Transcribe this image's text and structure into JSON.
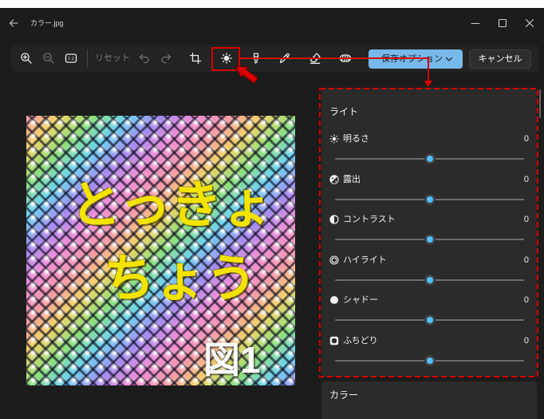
{
  "window": {
    "title": "カラー.jpg",
    "back_icon": "back-arrow-icon",
    "controls": [
      "minimize-icon",
      "maximize-icon",
      "close-icon"
    ]
  },
  "toolbar": {
    "fit_label": "1:1",
    "reset_label": "リセット",
    "save_label": "保存オプション",
    "cancel_label": "キャンセル",
    "tools": [
      "zoom-in-icon",
      "zoom-out-icon",
      "actual-size-icon",
      "undo-icon",
      "redo-icon",
      "crop-icon",
      "adjustment-icon",
      "markup-icon",
      "draw-icon",
      "spot-fix-icon",
      "filter-icon"
    ],
    "active_tool": "adjustment-icon"
  },
  "canvas": {
    "image_text_line1": "とっきょ",
    "image_text_line2": "ちょう",
    "figure_label": "図1"
  },
  "panel": {
    "light": {
      "title": "ライト",
      "sliders": [
        {
          "label": "明るさ",
          "value": 0,
          "icon": "brightness-icon"
        },
        {
          "label": "露出",
          "value": 0,
          "icon": "exposure-icon"
        },
        {
          "label": "コントラスト",
          "value": 0,
          "icon": "contrast-icon"
        },
        {
          "label": "ハイライト",
          "value": 0,
          "icon": "highlights-icon"
        },
        {
          "label": "シャドー",
          "value": 0,
          "icon": "shadows-icon"
        },
        {
          "label": "ふちどり",
          "value": 0,
          "icon": "vignette-icon"
        }
      ]
    },
    "color": {
      "title": "カラー"
    }
  },
  "colors": {
    "background": "#1c1c1c",
    "panel": "#2b2b2b",
    "accent": "#78b9ec",
    "slider_thumb": "#4cc2ff",
    "annotation": "#d80000"
  }
}
